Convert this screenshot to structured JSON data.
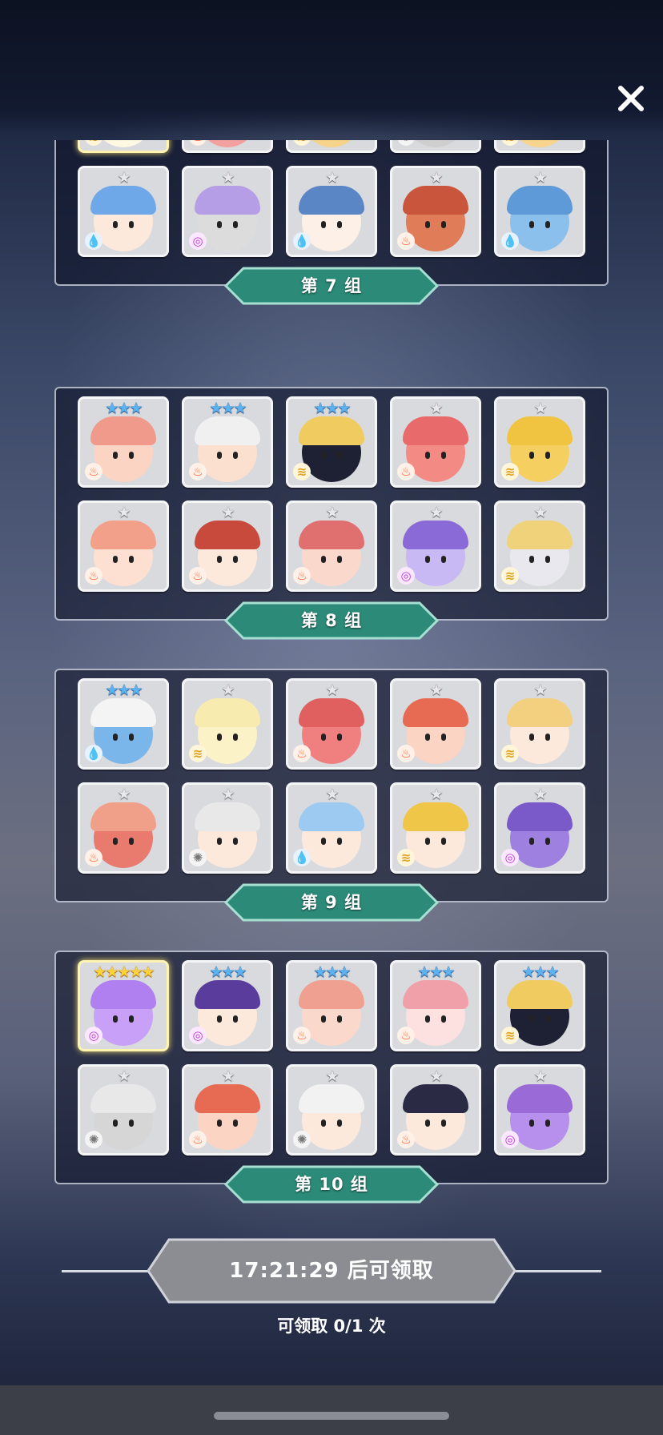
{
  "close_icon": "close-icon",
  "colors": {
    "label_fill": "#2c8a78",
    "label_border": "#a7e0d2",
    "timer_fill": "#8b8d92",
    "star_gray": "#e8e8ec",
    "star_blue": "#5ab2f0",
    "star_gold": "#ffd23a"
  },
  "groups": [
    {
      "label": "第 7 组",
      "heroes": [
        {
          "stars": 0,
          "element": "wind",
          "hair": "#fff3c4",
          "skin": "#fff8e3",
          "legend": true
        },
        {
          "stars": 0,
          "element": "fire",
          "hair": "#e98080",
          "skin": "#f2a0a0"
        },
        {
          "stars": 0,
          "element": "wind",
          "hair": "#f0c060",
          "skin": "#f6d38a"
        },
        {
          "stars": 0,
          "element": "light",
          "hair": "#eeeeee",
          "skin": "#cfcfcf"
        },
        {
          "stars": 0,
          "element": "wind",
          "hair": "#f0c49a",
          "skin": "#f7d58e"
        },
        {
          "stars": 1,
          "element": "water",
          "hair": "#6fa8e8",
          "skin": "#fde9dc"
        },
        {
          "stars": 1,
          "element": "dark",
          "hair": "#b59ee6",
          "skin": "#dcdcdc"
        },
        {
          "stars": 1,
          "element": "water",
          "hair": "#5b86c6",
          "skin": "#fdf0e6"
        },
        {
          "stars": 1,
          "element": "fire",
          "hair": "#c9563c",
          "skin": "#e07c58"
        },
        {
          "stars": 1,
          "element": "water",
          "hair": "#5f9ad8",
          "skin": "#8cc0ec"
        }
      ]
    },
    {
      "label": "第 8 组",
      "heroes": [
        {
          "stars": 3,
          "element": "fire",
          "hair": "#ef9a8a",
          "skin": "#fbd4c4"
        },
        {
          "stars": 3,
          "element": "fire",
          "hair": "#f0f0f0",
          "skin": "#fbe0d0"
        },
        {
          "stars": 3,
          "element": "wind",
          "hair": "#f0cc60",
          "skin": "#1e2033"
        },
        {
          "stars": 1,
          "element": "fire",
          "hair": "#e96a6a",
          "skin": "#f48a84"
        },
        {
          "stars": 1,
          "element": "wind",
          "hair": "#f0c440",
          "skin": "#f5d060"
        },
        {
          "stars": 1,
          "element": "fire",
          "hair": "#f2a08a",
          "skin": "#fde0d2"
        },
        {
          "stars": 1,
          "element": "fire",
          "hair": "#c84a3c",
          "skin": "#fde9dc"
        },
        {
          "stars": 1,
          "element": "fire",
          "hair": "#e07070",
          "skin": "#fbd8cc"
        },
        {
          "stars": 1,
          "element": "dark",
          "hair": "#8a6ad6",
          "skin": "#c8b8f4"
        },
        {
          "stars": 1,
          "element": "wind",
          "hair": "#f0d27a",
          "skin": "#e8e8ee"
        }
      ]
    },
    {
      "label": "第 9 组",
      "heroes": [
        {
          "stars": 3,
          "element": "water",
          "hair": "#f4f4f4",
          "skin": "#7bb6ea"
        },
        {
          "stars": 1,
          "element": "wind",
          "hair": "#f7ebb0",
          "skin": "#fbf2c8"
        },
        {
          "stars": 1,
          "element": "fire",
          "hair": "#e06060",
          "skin": "#f08080"
        },
        {
          "stars": 1,
          "element": "fire",
          "hair": "#e76a52",
          "skin": "#fbd4c4"
        },
        {
          "stars": 1,
          "element": "wind",
          "hair": "#f2d080",
          "skin": "#fde9dc"
        },
        {
          "stars": 1,
          "element": "fire",
          "hair": "#f0a088",
          "skin": "#e87a6e"
        },
        {
          "stars": 1,
          "element": "light",
          "hair": "#e8e8e8",
          "skin": "#fde9dc"
        },
        {
          "stars": 1,
          "element": "water",
          "hair": "#9ccaf0",
          "skin": "#fde9dc"
        },
        {
          "stars": 1,
          "element": "wind",
          "hair": "#f0c648",
          "skin": "#fde9dc"
        },
        {
          "stars": 1,
          "element": "dark",
          "hair": "#7a5ac8",
          "skin": "#9d80e0"
        }
      ]
    },
    {
      "label": "第 10 组",
      "heroes": [
        {
          "stars": 5,
          "element": "dark",
          "hair": "#b080f0",
          "skin": "#c8a0f8",
          "legend": true
        },
        {
          "stars": 3,
          "element": "dark",
          "hair": "#5a3c9c",
          "skin": "#fde9dc"
        },
        {
          "stars": 3,
          "element": "fire",
          "hair": "#f0a090",
          "skin": "#fbd8cc"
        },
        {
          "stars": 3,
          "element": "fire",
          "hair": "#f0a0a8",
          "skin": "#fde0e0"
        },
        {
          "stars": 3,
          "element": "wind",
          "hair": "#f0cc60",
          "skin": "#1e2033"
        },
        {
          "stars": 1,
          "element": "light",
          "hair": "#e8e8e8",
          "skin": "#d6d6d6"
        },
        {
          "stars": 1,
          "element": "fire",
          "hair": "#e76a52",
          "skin": "#fbd4c4"
        },
        {
          "stars": 1,
          "element": "light",
          "hair": "#f2f2f2",
          "skin": "#fde9dc"
        },
        {
          "stars": 1,
          "element": "fire",
          "hair": "#2a2a44",
          "skin": "#fde9dc"
        },
        {
          "stars": 1,
          "element": "dark",
          "hair": "#9a6ad6",
          "skin": "#b690ec"
        }
      ]
    }
  ],
  "timer": {
    "text": "17:21:29 后可领取",
    "claim_count": "可领取 0/1 次"
  }
}
